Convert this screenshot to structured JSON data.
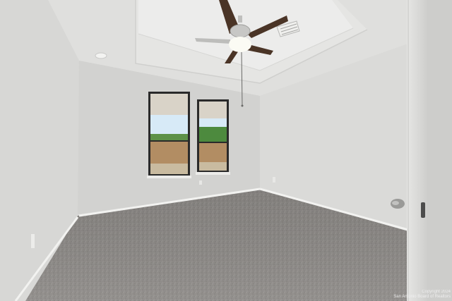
{
  "watermark": {
    "line1": "Copyright 2024",
    "line2": "San Antonio Board of Realtors"
  },
  "colors": {
    "left_wall": "#d8d8d6",
    "back_wall": "#d4d4d2",
    "right_wall": "#dcdcda",
    "ceiling": "#e2e2e0",
    "tray": "#ebebea",
    "carpet": "#8a8784",
    "baseboard": "#f1f1ef",
    "fan_blade": "#4a3426",
    "sky": "#d7eaf7",
    "fence": "#b08c64",
    "trees": "#4d8a3e"
  },
  "icons": [
    "ceiling-fan-icon",
    "air-vent-icon",
    "smoke-detector-icon",
    "door-knob-icon"
  ]
}
